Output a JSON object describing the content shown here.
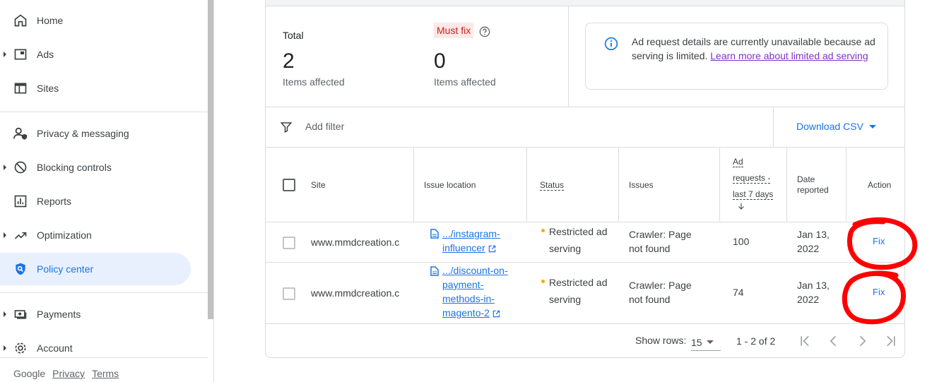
{
  "sidebar": {
    "items": [
      {
        "label": "Home",
        "icon": "home-icon",
        "expandable": false
      },
      {
        "label": "Ads",
        "icon": "ad-unit-icon",
        "expandable": true
      },
      {
        "label": "Sites",
        "icon": "sites-icon",
        "expandable": false
      },
      {
        "label": "Privacy & messaging",
        "icon": "privacy-person-icon",
        "expandable": false
      },
      {
        "label": "Blocking controls",
        "icon": "block-icon",
        "expandable": true
      },
      {
        "label": "Reports",
        "icon": "reports-icon",
        "expandable": false
      },
      {
        "label": "Optimization",
        "icon": "trending-up-icon",
        "expandable": true
      },
      {
        "label": "Policy center",
        "icon": "policy-shield-icon",
        "expandable": false,
        "active": true
      },
      {
        "label": "Payments",
        "icon": "payments-icon",
        "expandable": true
      },
      {
        "label": "Account",
        "icon": "gear-icon",
        "expandable": true
      }
    ],
    "footer": {
      "brand": "Google",
      "privacy": "Privacy",
      "terms": "Terms"
    }
  },
  "summary": {
    "total_label": "Total",
    "total_value": "2",
    "total_sub": "Items affected",
    "mustfix_label": "Must fix",
    "mustfix_value": "0",
    "mustfix_sub": "Items affected"
  },
  "notice": {
    "text": "Ad request details are currently unavailable because ad serving is limited. ",
    "link": "Learn more about limited ad serving"
  },
  "toolbar": {
    "add_filter": "Add filter",
    "download": "Download CSV"
  },
  "table": {
    "headers": {
      "site": "Site",
      "issue_location": "Issue location",
      "status": "Status",
      "issues": "Issues",
      "ad_requests_1": "Ad",
      "ad_requests_2": "requests -",
      "ad_requests_3": "last 7 days",
      "date_1": "Date",
      "date_2": "reported",
      "action": "Action"
    },
    "rows": [
      {
        "site": "www.mmdcreation.c",
        "location_lines": [
          ".../instagram-",
          "influencer"
        ],
        "status_1": "Restricted ad",
        "status_2": "serving",
        "issue_1": "Crawler: Page",
        "issue_2": "not found",
        "ad_requests": "100",
        "date_1": "Jan 13,",
        "date_2": "2022",
        "action": "Fix"
      },
      {
        "site": "www.mmdcreation.c",
        "location_lines": [
          ".../discount-on-",
          "payment-",
          "methods-in-",
          "magento-2"
        ],
        "status_1": "Restricted ad",
        "status_2": "serving",
        "issue_1": "Crawler: Page",
        "issue_2": "not found",
        "ad_requests": "74",
        "date_1": "Jan 13,",
        "date_2": "2022",
        "action": "Fix"
      }
    ]
  },
  "pagination": {
    "show_rows_label": "Show rows:",
    "rows_value": "15",
    "range": "1 - 2 of 2"
  },
  "colors": {
    "accent": "#1a73e8",
    "mustfix_bg": "#fce8e6",
    "mustfix_text": "#c5221f",
    "status_dot": "#f9ab00",
    "annotation": "#ff0000"
  }
}
